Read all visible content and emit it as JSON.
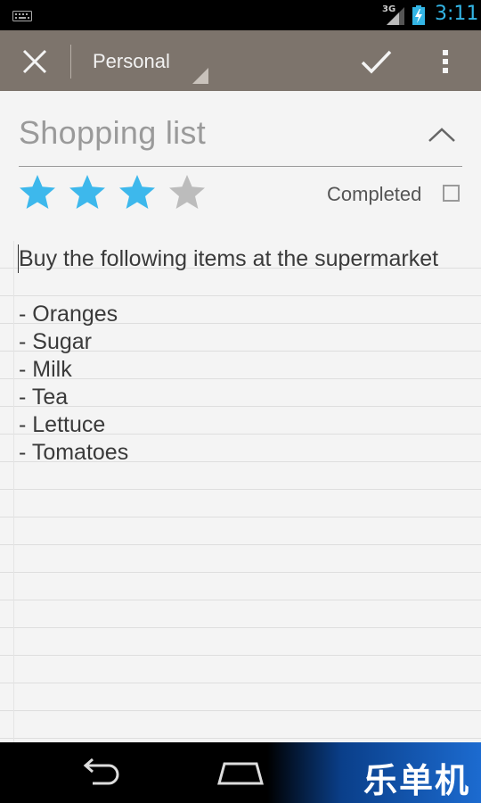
{
  "status_bar": {
    "network": "3G",
    "time": "3:11",
    "clock_color": "#33b5e5"
  },
  "action_bar": {
    "category": "Personal",
    "background": "#7d746c",
    "icons": [
      "close-icon",
      "check-icon",
      "overflow-menu-icon"
    ]
  },
  "note": {
    "title": "Shopping list",
    "rating": 3,
    "max_rating": 5,
    "star_color_active": "#3db8ec",
    "star_color_inactive": "#bcbcbc",
    "completed_label": "Completed",
    "completed": false,
    "body": "Buy the following items at the supermarket\n\n- Oranges\n- Sugar\n- Milk\n- Tea\n- Lettuce\n- Tomatoes"
  },
  "nav_bar": {
    "icons": [
      "back-icon",
      "home-icon"
    ],
    "watermark": "乐单机"
  }
}
